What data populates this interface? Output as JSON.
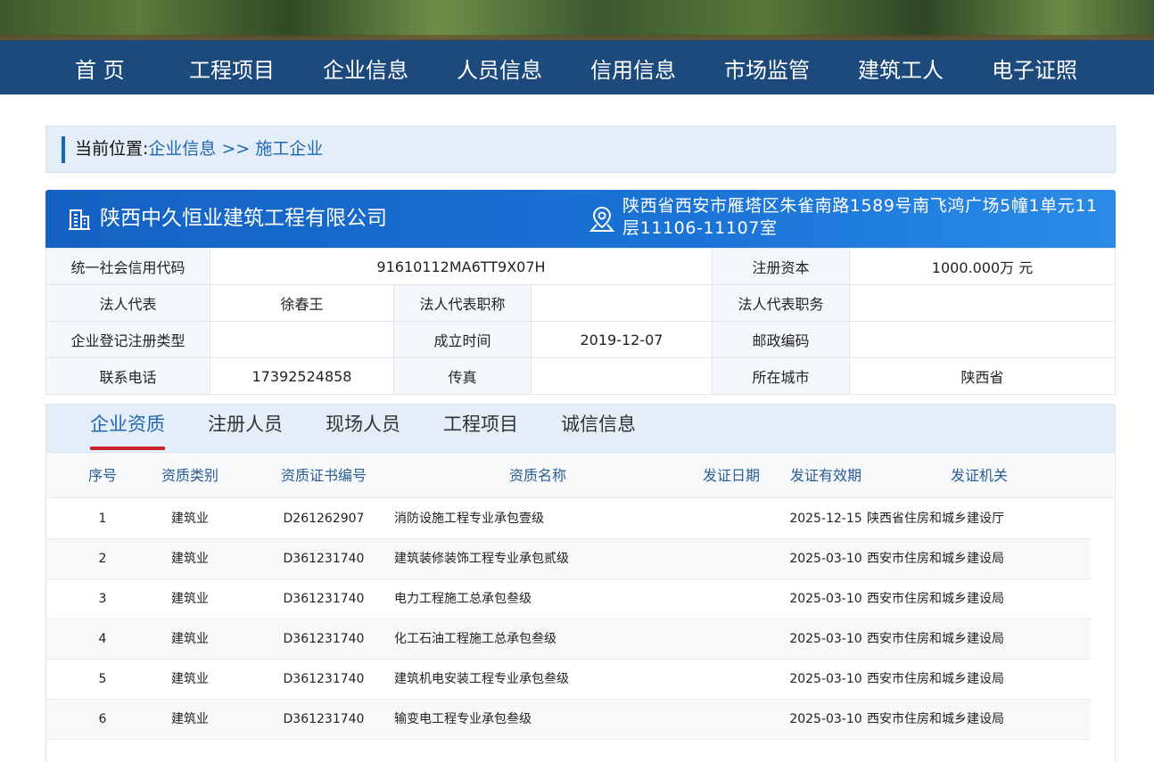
{
  "nav": {
    "items": [
      "首 页",
      "工程项目",
      "企业信息",
      "人员信息",
      "信用信息",
      "市场监管",
      "建筑工人",
      "电子证照"
    ]
  },
  "breadcrumb": {
    "current_label": "当前位置:",
    "path": "企业信息 >> 施工企业"
  },
  "company": {
    "name": "陕西中久恒业建筑工程有限公司",
    "address": "陕西省西安市雁塔区朱雀南路1589号南飞鸿广场5幢1单元11层11106-11107室"
  },
  "info": {
    "credit_code_label": "统一社会信用代码",
    "credit_code": "91610112MA6TT9X07H",
    "capital_label": "注册资本",
    "capital": "1000.000万 元",
    "legal_rep_label": "法人代表",
    "legal_rep": "徐春王",
    "legal_title_label": "法人代表职称",
    "legal_title": "",
    "legal_position_label": "法人代表职务",
    "legal_position": "",
    "reg_type_label": "企业登记注册类型",
    "reg_type": "",
    "founded_label": "成立时间",
    "founded": "2019-12-07",
    "postcode_label": "邮政编码",
    "postcode": "",
    "phone_label": "联系电话",
    "phone": "17392524858",
    "fax_label": "传真",
    "fax": "",
    "city_label": "所在城市",
    "city": "陕西省"
  },
  "tabs": [
    "企业资质",
    "注册人员",
    "现场人员",
    "工程项目",
    "诚信信息"
  ],
  "table": {
    "headers": [
      "序号",
      "资质类别",
      "资质证书编号",
      "资质名称",
      "发证日期",
      "发证有效期",
      "发证机关"
    ],
    "rows": [
      [
        "1",
        "建筑业",
        "D261262907",
        "消防设施工程专业承包壹级",
        "",
        "2025-12-15",
        "陕西省住房和城乡建设厅"
      ],
      [
        "2",
        "建筑业",
        "D361231740",
        "建筑装修装饰工程专业承包贰级",
        "",
        "2025-03-10",
        "西安市住房和城乡建设局"
      ],
      [
        "3",
        "建筑业",
        "D361231740",
        "电力工程施工总承包叁级",
        "",
        "2025-03-10",
        "西安市住房和城乡建设局"
      ],
      [
        "4",
        "建筑业",
        "D361231740",
        "化工石油工程施工总承包叁级",
        "",
        "2025-03-10",
        "西安市住房和城乡建设局"
      ],
      [
        "5",
        "建筑业",
        "D361231740",
        "建筑机电安装工程专业承包叁级",
        "",
        "2025-03-10",
        "西安市住房和城乡建设局"
      ],
      [
        "6",
        "建筑业",
        "D361231740",
        "输变电工程专业承包叁级",
        "",
        "2025-03-10",
        "西安市住房和城乡建设局"
      ]
    ]
  }
}
